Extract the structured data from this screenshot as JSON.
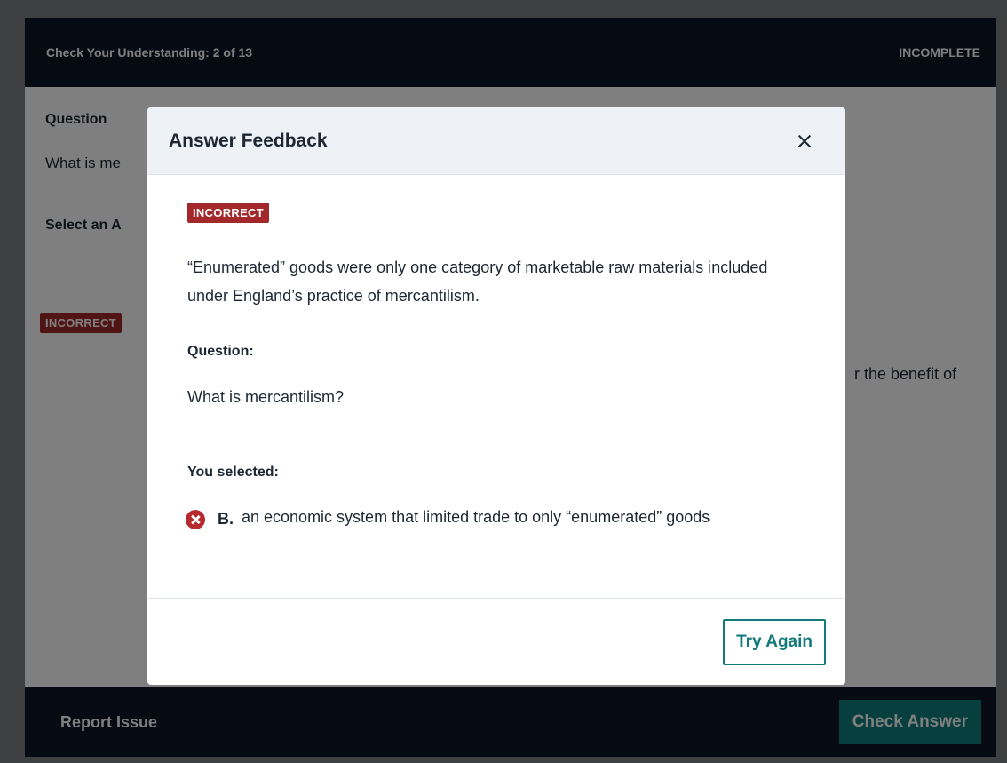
{
  "quiz": {
    "header_title": "Check Your Understanding: 2 of 13",
    "status": "INCOMPLETE",
    "question_label": "Question",
    "question_text_partial": "What is me",
    "select_label_partial": "Select an A",
    "incorrect_badge": "INCORRECT",
    "answer_tail": "r the benefit of",
    "report_issue": "Report Issue",
    "check_answer": "Check Answer"
  },
  "modal": {
    "title": "Answer Feedback",
    "badge": "INCORRECT",
    "feedback": "“Enumerated” goods were only one category of marketable raw materials included under England’s practice of mercantilism.",
    "question_label": "Question:",
    "question_text": "What is mercantilism?",
    "selected_label": "You selected:",
    "selected_letter": "B.",
    "selected_text": "an economic system that limited trade to only “enumerated” goods",
    "try_again": "Try Again"
  },
  "colors": {
    "header_bg": "#0c1726",
    "incorrect": "#a3282b",
    "accent": "#127a7a"
  },
  "icons": {
    "close": "close-icon",
    "incorrect_mark": "x-circle-icon"
  }
}
